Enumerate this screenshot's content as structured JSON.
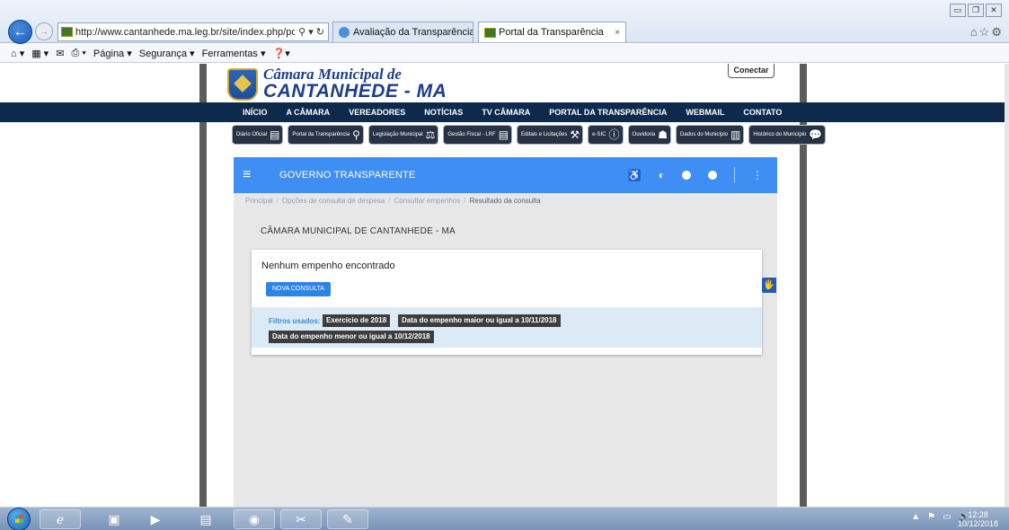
{
  "browser": {
    "address": "http://www.cantanhede.ma.leg.br/site/index.php/por",
    "address_tools": "⚲ ▾ ↻",
    "tabs": [
      {
        "label": "Avaliação da Transparência do..."
      },
      {
        "label": "Portal da Transparência",
        "close": "×"
      }
    ],
    "window_buttons": [
      "▭",
      "❐",
      "✕"
    ],
    "browser_icons": "⌂☆⚙",
    "command_bar": [
      "⌂ ▾",
      "▦ ▾",
      "✉",
      "⎙ ▾",
      "Página ▾",
      "Segurança ▾",
      "Ferramentas ▾",
      "❓▾"
    ]
  },
  "site": {
    "logo_line1": "Câmara Municipal de",
    "logo_line2": "CANTANHEDE - MA",
    "connect": "Conectar",
    "nav": [
      "INÍCIO",
      "A CÂMARA",
      "VEREADORES",
      "NOTÍCIAS",
      "TV CÂMARA",
      "PORTAL DA TRANSPARÊNCIA",
      "WEBMAIL",
      "CONTATO"
    ],
    "quick_links": [
      {
        "label": "Diário Oficial",
        "icon": "▤"
      },
      {
        "label": "Portal da Transparência",
        "icon": "⚲"
      },
      {
        "label": "Legislação Municipal",
        "icon": "⚖"
      },
      {
        "label": "Gestão Fiscal - LRF",
        "icon": "▤"
      },
      {
        "label": "Editais e Licitações",
        "icon": "⚒"
      },
      {
        "label": "e-SIC",
        "icon": "ⓘ"
      },
      {
        "label": "Ouvidoria",
        "icon": "☗"
      },
      {
        "label": "Dados do Município",
        "icon": "▥"
      },
      {
        "label": "Histórico do Município",
        "icon": "💬"
      }
    ]
  },
  "gov_bar": {
    "menu_icon": "≡",
    "title": "GOVERNO TRANSPARENTE",
    "accessibility_icon": "♿",
    "contrast_icon": "◐",
    "more_icon": "⋮"
  },
  "breadcrumb": {
    "items": [
      "Principal",
      "Opções de consulta de despesa",
      "Consultar empenhos"
    ],
    "separator": "/",
    "current": "Resultado da consulta"
  },
  "content": {
    "entity": "CÂMARA MUNICIPAL DE CANTANHEDE - MA",
    "no_result": "Nenhum empenho encontrado",
    "new_query": "NOVA CONSULTA",
    "filters_label": "Filtros usados:",
    "filters": [
      "Exercício de 2018",
      "Data do empenho maior ou igual a 10/11/2018",
      "Data do empenho menor ou igual a 10/12/2018"
    ],
    "accessibility_widget": "🖐"
  },
  "taskbar": {
    "apps": [
      {
        "name": "ie",
        "icon": "ℯ"
      },
      {
        "name": "explorer",
        "icon": "▣"
      },
      {
        "name": "media-player",
        "icon": "▶"
      },
      {
        "name": "document",
        "icon": "▤"
      },
      {
        "name": "chrome",
        "icon": "◉"
      },
      {
        "name": "paint",
        "icon": "✂"
      },
      {
        "name": "project",
        "icon": "✎"
      }
    ],
    "tray": [
      "▲",
      "⚑",
      "▭",
      "🔊"
    ],
    "time": "12:28",
    "date": "10/12/2018"
  }
}
